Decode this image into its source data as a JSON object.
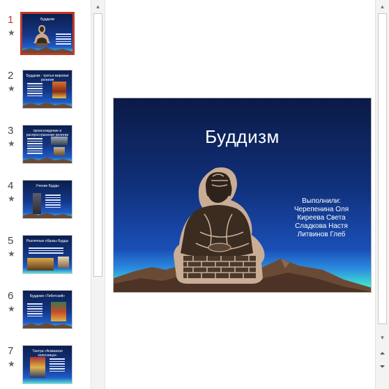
{
  "thumbnails": [
    {
      "number": "1",
      "title": "Буддизм",
      "active": true
    },
    {
      "number": "2",
      "title": "Буддизм - третья мировая религия",
      "active": false
    },
    {
      "number": "3",
      "title": "происхождение и распространение религии",
      "active": false
    },
    {
      "number": "4",
      "title": "Учение Будды",
      "active": false
    },
    {
      "number": "5",
      "title": "Различные образы Будды",
      "active": false
    },
    {
      "number": "6",
      "title": "Буддизм «Тибетский»",
      "active": false
    },
    {
      "number": "7",
      "title": "Тантра «Алмазная колесница»",
      "active": false
    }
  ],
  "thumb_star_icon": "star-icon",
  "slide": {
    "title": "Буддизм",
    "authors": [
      "Выполнили:",
      "Черепенина Оля",
      "Киреева Света",
      "Сладкова Настя",
      "Литвинов Глеб"
    ]
  },
  "colors": {
    "active_border": "#c0392b",
    "slide_top": "#0b1a45",
    "slide_bottom": "#59f0d4"
  }
}
